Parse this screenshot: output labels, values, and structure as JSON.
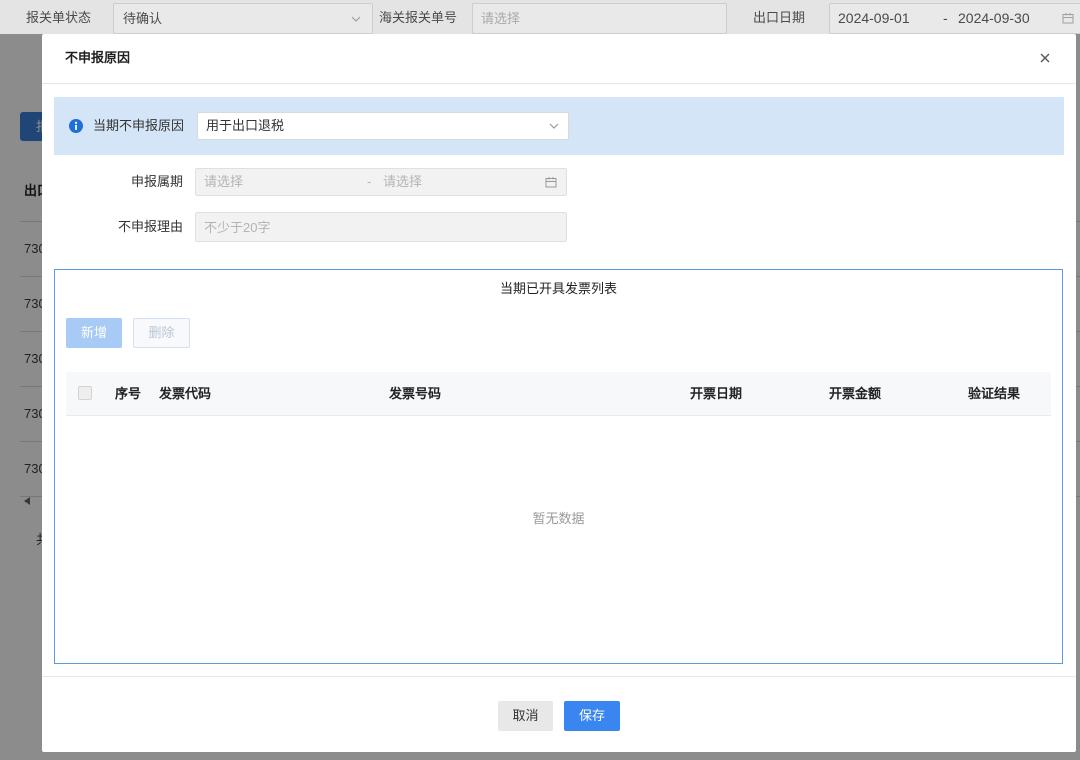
{
  "colors": {
    "accent": "#3a86f0",
    "info_bar": "#d5e5f8",
    "info_icon": "#1e6fd9",
    "list_border": "#5b9be0",
    "add_disabled": "#a7cbf5",
    "overlay": "rgba(0,0,0,0.45)"
  },
  "icons": {
    "close": "close-icon",
    "reason_info": "info-icon",
    "dropdown": "chevron-down-icon",
    "calendar": "calendar-icon",
    "scroll_left": "caret-left-icon"
  },
  "page": {
    "filters": {
      "status_label": "报关单状态",
      "status_value": "待确认",
      "customs_no_label": "海关报关单号",
      "customs_no_placeholder": "请选择",
      "export_date_label": "出口日期",
      "export_date_start": "2024-09-01",
      "export_date_separator": "-",
      "export_date_end": "2024-09-30"
    },
    "action_button_label": "报",
    "table": {
      "header": "出口",
      "rows": [
        "730",
        "730",
        "730",
        "730",
        "730"
      ]
    },
    "pagination_text": "共"
  },
  "dialog": {
    "title": "不申报原因",
    "reason": {
      "label": "当期不申报原因",
      "value": "用于出口退税"
    },
    "period": {
      "label": "申报属期",
      "start_placeholder": "请选择",
      "separator": "-",
      "end_placeholder": "请选择"
    },
    "explanation": {
      "label": "不申报理由",
      "placeholder": "不少于20字"
    },
    "invoice_list": {
      "title": "当期已开具发票列表",
      "add_label": "新增",
      "delete_label": "删除",
      "columns": [
        "序号",
        "发票代码",
        "发票号码",
        "开票日期",
        "开票金额",
        "验证结果"
      ],
      "rows": [],
      "empty_text": "暂无数据"
    },
    "footer": {
      "cancel_label": "取消",
      "save_label": "保存"
    }
  }
}
